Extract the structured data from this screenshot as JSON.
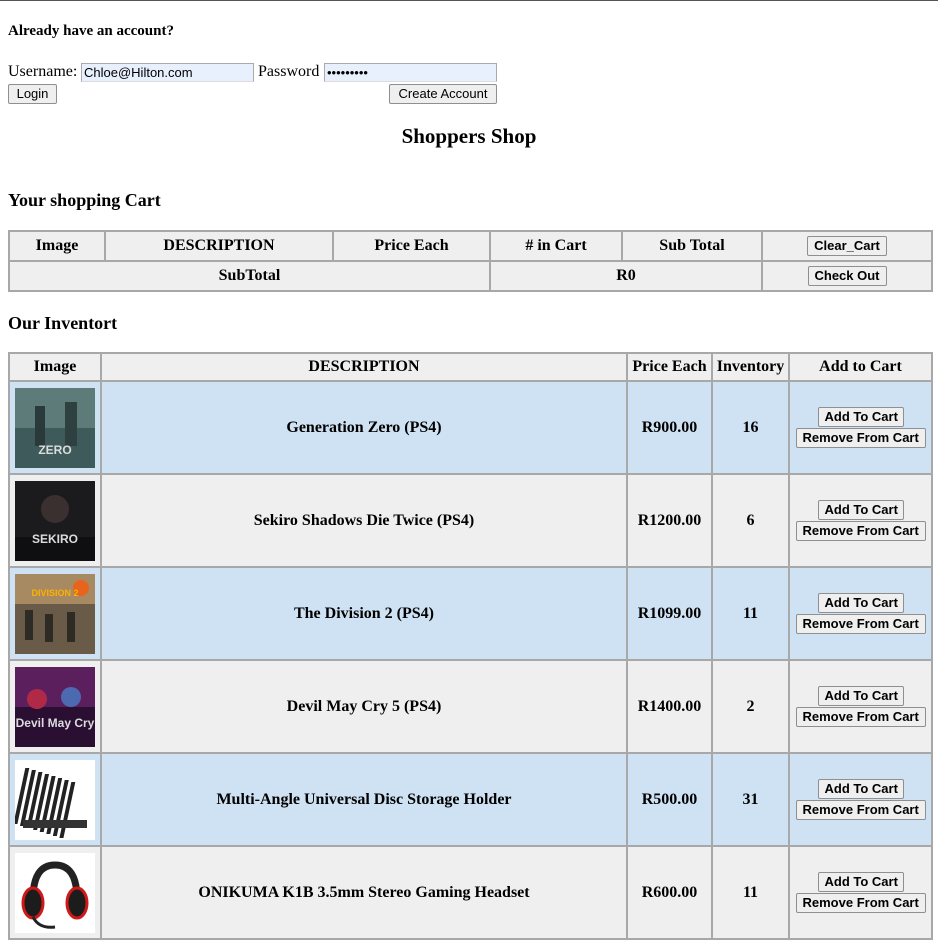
{
  "login": {
    "heading": "Already have an account?",
    "username_label": "Username:",
    "username_value": "Chloe@Hilton.com",
    "password_label": "Password",
    "password_value": "•••••••••",
    "login_button": "Login",
    "create_button": "Create Account"
  },
  "shop_title": "Shoppers Shop",
  "cart": {
    "heading": "Your shopping Cart",
    "headers": [
      "Image",
      "DESCRIPTION",
      "Price Each",
      "# in Cart",
      "Sub Total"
    ],
    "clear_button": "Clear_Cart",
    "subtotal_label": "SubTotal",
    "subtotal_value": "R0",
    "checkout_button": "Check Out"
  },
  "inventory": {
    "heading": "Our Inventort",
    "headers": [
      "Image",
      "DESCRIPTION",
      "Price Each",
      "Inventory",
      "Add to Cart"
    ],
    "add_label": "Add To Cart",
    "remove_label": "Remove From Cart",
    "items": [
      {
        "description": "Generation Zero (PS4)",
        "price": "R900.00",
        "inventory": "16",
        "thumb_text": "ZERO",
        "thumb_bg": "#3e5a5a"
      },
      {
        "description": "Sekiro Shadows Die Twice (PS4)",
        "price": "R1200.00",
        "inventory": "6",
        "thumb_text": "SEKIRO",
        "thumb_bg": "#1b1b1e"
      },
      {
        "description": "The Division 2 (PS4)",
        "price": "R1099.00",
        "inventory": "11",
        "thumb_text": "DIVISION 2",
        "thumb_bg": "#6a5a48"
      },
      {
        "description": "Devil May Cry 5 (PS4)",
        "price": "R1400.00",
        "inventory": "2",
        "thumb_text": "Devil May Cry",
        "thumb_bg": "#3a1840"
      },
      {
        "description": "Multi-Angle Universal Disc Storage Holder",
        "price": "R500.00",
        "inventory": "31",
        "thumb_text": "",
        "thumb_bg": "#ffffff"
      },
      {
        "description": "ONIKUMA K1B 3.5mm Stereo Gaming Headset",
        "price": "R600.00",
        "inventory": "11",
        "thumb_text": "",
        "thumb_bg": "#ffffff"
      }
    ]
  }
}
